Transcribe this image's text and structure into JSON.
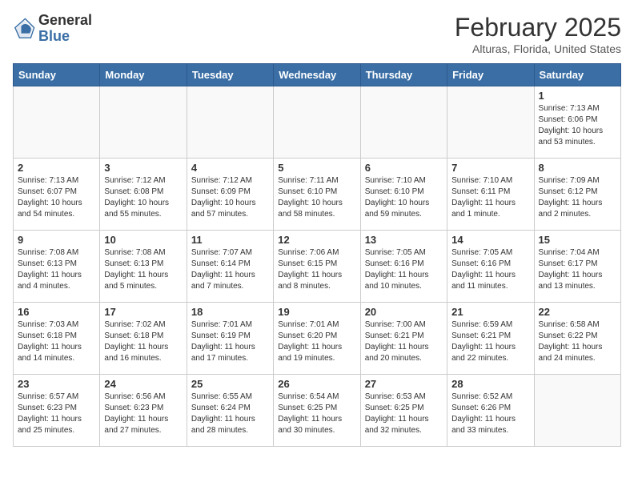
{
  "header": {
    "logo": {
      "general": "General",
      "blue": "Blue"
    },
    "title": "February 2025",
    "location": "Alturas, Florida, United States"
  },
  "weekdays": [
    "Sunday",
    "Monday",
    "Tuesday",
    "Wednesday",
    "Thursday",
    "Friday",
    "Saturday"
  ],
  "weeks": [
    [
      {
        "day": null
      },
      {
        "day": null
      },
      {
        "day": null
      },
      {
        "day": null
      },
      {
        "day": null
      },
      {
        "day": null
      },
      {
        "day": 1,
        "sunrise": "7:13 AM",
        "sunset": "6:06 PM",
        "daylight": "10 hours and 53 minutes."
      }
    ],
    [
      {
        "day": 2,
        "sunrise": "7:13 AM",
        "sunset": "6:07 PM",
        "daylight": "10 hours and 54 minutes."
      },
      {
        "day": 3,
        "sunrise": "7:12 AM",
        "sunset": "6:08 PM",
        "daylight": "10 hours and 55 minutes."
      },
      {
        "day": 4,
        "sunrise": "7:12 AM",
        "sunset": "6:09 PM",
        "daylight": "10 hours and 57 minutes."
      },
      {
        "day": 5,
        "sunrise": "7:11 AM",
        "sunset": "6:10 PM",
        "daylight": "10 hours and 58 minutes."
      },
      {
        "day": 6,
        "sunrise": "7:10 AM",
        "sunset": "6:10 PM",
        "daylight": "10 hours and 59 minutes."
      },
      {
        "day": 7,
        "sunrise": "7:10 AM",
        "sunset": "6:11 PM",
        "daylight": "11 hours and 1 minute."
      },
      {
        "day": 8,
        "sunrise": "7:09 AM",
        "sunset": "6:12 PM",
        "daylight": "11 hours and 2 minutes."
      }
    ],
    [
      {
        "day": 9,
        "sunrise": "7:08 AM",
        "sunset": "6:13 PM",
        "daylight": "11 hours and 4 minutes."
      },
      {
        "day": 10,
        "sunrise": "7:08 AM",
        "sunset": "6:13 PM",
        "daylight": "11 hours and 5 minutes."
      },
      {
        "day": 11,
        "sunrise": "7:07 AM",
        "sunset": "6:14 PM",
        "daylight": "11 hours and 7 minutes."
      },
      {
        "day": 12,
        "sunrise": "7:06 AM",
        "sunset": "6:15 PM",
        "daylight": "11 hours and 8 minutes."
      },
      {
        "day": 13,
        "sunrise": "7:05 AM",
        "sunset": "6:16 PM",
        "daylight": "11 hours and 10 minutes."
      },
      {
        "day": 14,
        "sunrise": "7:05 AM",
        "sunset": "6:16 PM",
        "daylight": "11 hours and 11 minutes."
      },
      {
        "day": 15,
        "sunrise": "7:04 AM",
        "sunset": "6:17 PM",
        "daylight": "11 hours and 13 minutes."
      }
    ],
    [
      {
        "day": 16,
        "sunrise": "7:03 AM",
        "sunset": "6:18 PM",
        "daylight": "11 hours and 14 minutes."
      },
      {
        "day": 17,
        "sunrise": "7:02 AM",
        "sunset": "6:18 PM",
        "daylight": "11 hours and 16 minutes."
      },
      {
        "day": 18,
        "sunrise": "7:01 AM",
        "sunset": "6:19 PM",
        "daylight": "11 hours and 17 minutes."
      },
      {
        "day": 19,
        "sunrise": "7:01 AM",
        "sunset": "6:20 PM",
        "daylight": "11 hours and 19 minutes."
      },
      {
        "day": 20,
        "sunrise": "7:00 AM",
        "sunset": "6:21 PM",
        "daylight": "11 hours and 20 minutes."
      },
      {
        "day": 21,
        "sunrise": "6:59 AM",
        "sunset": "6:21 PM",
        "daylight": "11 hours and 22 minutes."
      },
      {
        "day": 22,
        "sunrise": "6:58 AM",
        "sunset": "6:22 PM",
        "daylight": "11 hours and 24 minutes."
      }
    ],
    [
      {
        "day": 23,
        "sunrise": "6:57 AM",
        "sunset": "6:23 PM",
        "daylight": "11 hours and 25 minutes."
      },
      {
        "day": 24,
        "sunrise": "6:56 AM",
        "sunset": "6:23 PM",
        "daylight": "11 hours and 27 minutes."
      },
      {
        "day": 25,
        "sunrise": "6:55 AM",
        "sunset": "6:24 PM",
        "daylight": "11 hours and 28 minutes."
      },
      {
        "day": 26,
        "sunrise": "6:54 AM",
        "sunset": "6:25 PM",
        "daylight": "11 hours and 30 minutes."
      },
      {
        "day": 27,
        "sunrise": "6:53 AM",
        "sunset": "6:25 PM",
        "daylight": "11 hours and 32 minutes."
      },
      {
        "day": 28,
        "sunrise": "6:52 AM",
        "sunset": "6:26 PM",
        "daylight": "11 hours and 33 minutes."
      },
      {
        "day": null
      }
    ]
  ]
}
